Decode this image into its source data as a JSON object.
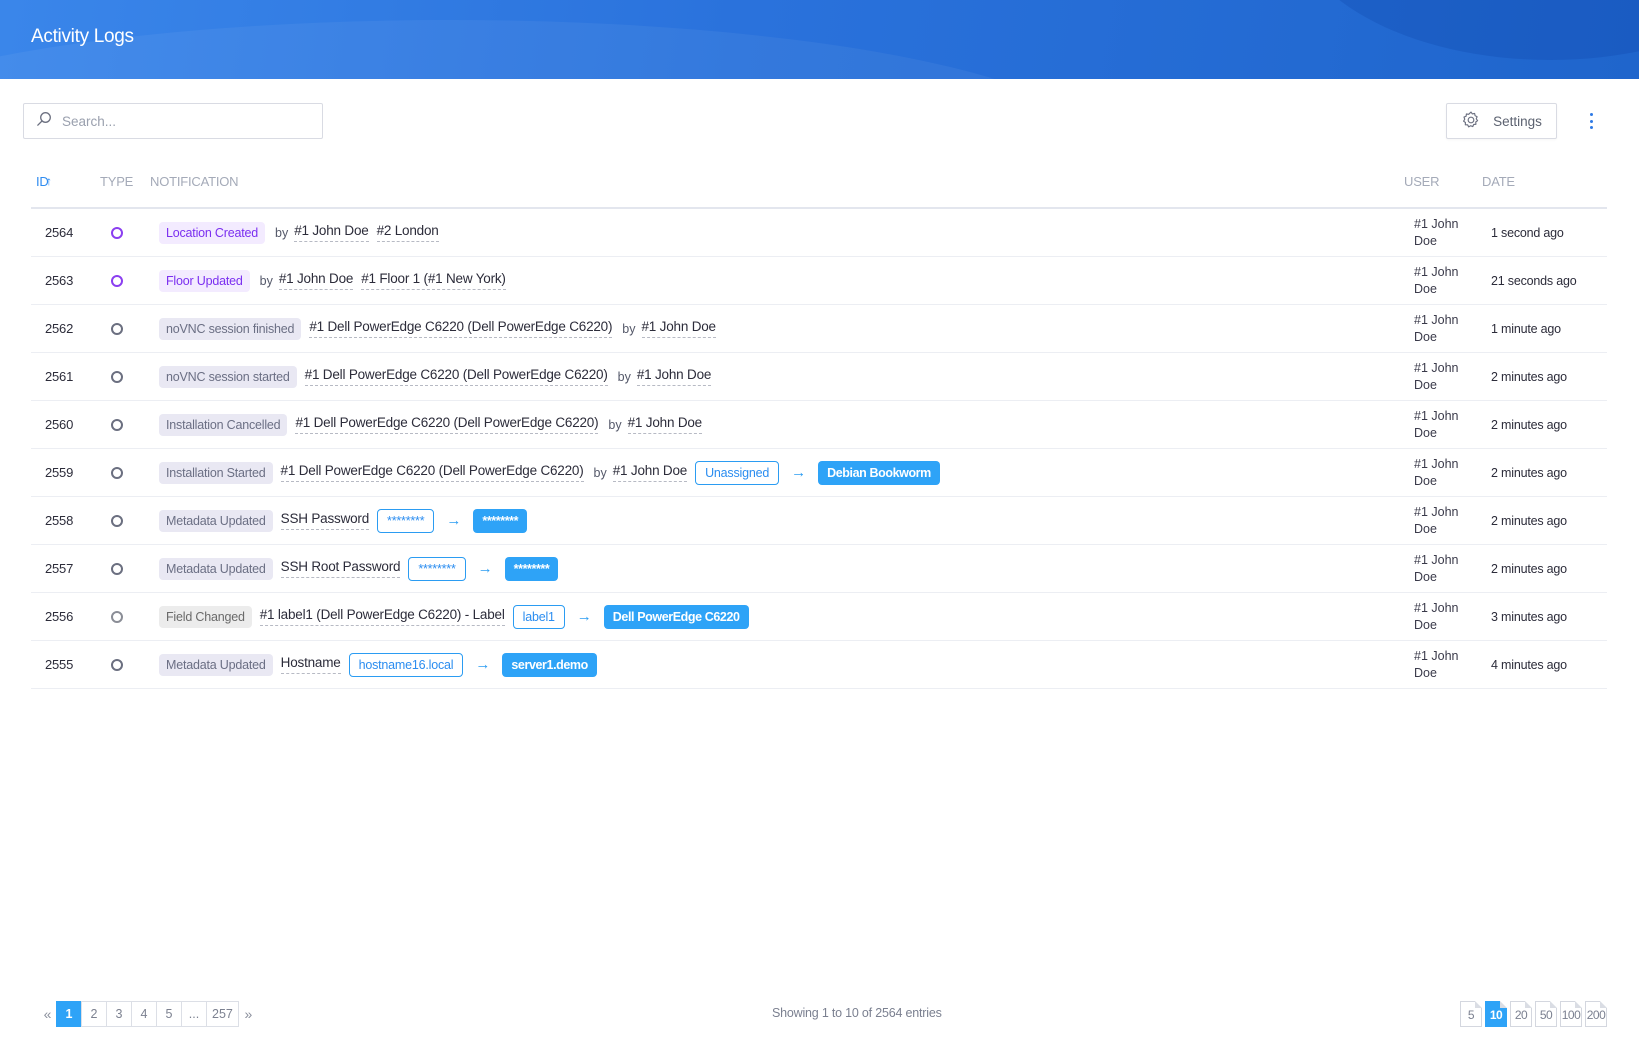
{
  "header": {
    "title": "Activity Logs"
  },
  "toolbar": {
    "search_placeholder": "Search...",
    "search_value": "",
    "settings_label": "Settings"
  },
  "table": {
    "columns": {
      "id": "ID",
      "type": "TYPE",
      "notification": "NOTIFICATION",
      "user": "USER",
      "date": "DATE"
    },
    "sort": {
      "column": "ID",
      "direction": "ascending-arrow"
    },
    "rows": [
      {
        "id": "2564",
        "type_color": "purple",
        "tag": "Location Created",
        "tag_style": "purple",
        "parts": [
          {
            "kind": "by",
            "text": "by"
          },
          {
            "kind": "link",
            "text": "#1 John Doe"
          },
          {
            "kind": "link",
            "text": "#2 London"
          }
        ],
        "user": "#1 John Doe",
        "date": "1 second ago"
      },
      {
        "id": "2563",
        "type_color": "purple",
        "tag": "Floor Updated",
        "tag_style": "purple",
        "parts": [
          {
            "kind": "by",
            "text": "by"
          },
          {
            "kind": "link",
            "text": "#1 John Doe"
          },
          {
            "kind": "link",
            "text": "#1 Floor 1 (#1 New York)"
          }
        ],
        "user": "#1 John Doe",
        "date": "21 seconds ago"
      },
      {
        "id": "2562",
        "type_color": "default",
        "tag": "noVNC session finished",
        "tag_style": "default",
        "parts": [
          {
            "kind": "link",
            "text": "#1 Dell PowerEdge C6220 (Dell PowerEdge C6220)"
          },
          {
            "kind": "by",
            "text": "by"
          },
          {
            "kind": "link",
            "text": "#1 John Doe"
          }
        ],
        "user": "#1 John Doe",
        "date": "1 minute ago"
      },
      {
        "id": "2561",
        "type_color": "default",
        "tag": "noVNC session started",
        "tag_style": "default",
        "parts": [
          {
            "kind": "link",
            "text": "#1 Dell PowerEdge C6220 (Dell PowerEdge C6220)"
          },
          {
            "kind": "by",
            "text": "by"
          },
          {
            "kind": "link",
            "text": "#1 John Doe"
          }
        ],
        "user": "#1 John Doe",
        "date": "2 minutes ago"
      },
      {
        "id": "2560",
        "type_color": "default",
        "tag": "Installation Cancelled",
        "tag_style": "default",
        "parts": [
          {
            "kind": "link",
            "text": "#1 Dell PowerEdge C6220 (Dell PowerEdge C6220)"
          },
          {
            "kind": "by",
            "text": "by"
          },
          {
            "kind": "link",
            "text": "#1 John Doe"
          }
        ],
        "user": "#1 John Doe",
        "date": "2 minutes ago"
      },
      {
        "id": "2559",
        "type_color": "default",
        "tag": "Installation Started",
        "tag_style": "default",
        "parts": [
          {
            "kind": "link",
            "text": "#1 Dell PowerEdge C6220 (Dell PowerEdge C6220)"
          },
          {
            "kind": "by",
            "text": "by"
          },
          {
            "kind": "link",
            "text": "#1 John Doe"
          },
          {
            "kind": "old",
            "text": "Unassigned"
          },
          {
            "kind": "arrow",
            "text": "→"
          },
          {
            "kind": "new",
            "text": "Debian Bookworm"
          }
        ],
        "user": "#1 John Doe",
        "date": "2 minutes ago"
      },
      {
        "id": "2558",
        "type_color": "default",
        "tag": "Metadata Updated",
        "tag_style": "default",
        "parts": [
          {
            "kind": "link",
            "text": "SSH Password"
          },
          {
            "kind": "old",
            "text": "********"
          },
          {
            "kind": "arrow",
            "text": "→"
          },
          {
            "kind": "new",
            "text": "********"
          }
        ],
        "user": "#1 John Doe",
        "date": "2 minutes ago"
      },
      {
        "id": "2557",
        "type_color": "default",
        "tag": "Metadata Updated",
        "tag_style": "default",
        "parts": [
          {
            "kind": "link",
            "text": "SSH Root Password"
          },
          {
            "kind": "old",
            "text": "********"
          },
          {
            "kind": "arrow",
            "text": "→"
          },
          {
            "kind": "new",
            "text": "********"
          }
        ],
        "user": "#1 John Doe",
        "date": "2 minutes ago"
      },
      {
        "id": "2556",
        "type_color": "gray",
        "tag": "Field Changed",
        "tag_style": "gray",
        "parts": [
          {
            "kind": "link",
            "text": "#1 label1 (Dell PowerEdge C6220) - Label"
          },
          {
            "kind": "old",
            "text": "label1"
          },
          {
            "kind": "arrow",
            "text": "→"
          },
          {
            "kind": "new",
            "text": "Dell PowerEdge C6220"
          }
        ],
        "user": "#1 John Doe",
        "date": "3 minutes ago"
      },
      {
        "id": "2555",
        "type_color": "default",
        "tag": "Metadata Updated",
        "tag_style": "default",
        "parts": [
          {
            "kind": "link",
            "text": "Hostname"
          },
          {
            "kind": "old",
            "text": "hostname16.local"
          },
          {
            "kind": "arrow",
            "text": "→"
          },
          {
            "kind": "new",
            "text": "server1.demo"
          }
        ],
        "user": "#1 John Doe",
        "date": "4 minutes ago"
      }
    ]
  },
  "pagination": {
    "prev": "«",
    "next": "»",
    "pages": [
      "1",
      "2",
      "3",
      "4",
      "5",
      "...",
      "257"
    ],
    "current": "1",
    "summary": "Showing 1 to 10 of 2564 entries",
    "page_sizes": [
      "5",
      "10",
      "20",
      "50",
      "100",
      "200"
    ],
    "current_page_size": "10"
  },
  "colors": {
    "header": "#2a72dc",
    "accent": "#2ea3f7",
    "purple": "#7b2ff0"
  }
}
